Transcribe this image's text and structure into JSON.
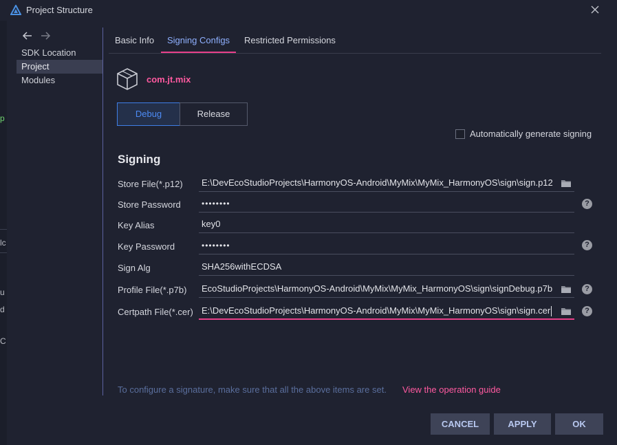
{
  "window": {
    "title": "Project Structure",
    "app_icon": "deveco-triangle-icon",
    "close_icon": "close-icon"
  },
  "left_edge": {
    "chars": [
      "p",
      "lc",
      "u",
      "d",
      "C"
    ]
  },
  "sidebar": {
    "back_icon": "arrow-left-icon",
    "forward_icon": "arrow-right-icon",
    "items": [
      {
        "label": "SDK Location"
      },
      {
        "label": "Project"
      },
      {
        "label": "Modules"
      }
    ],
    "selected": "Project"
  },
  "tabs": [
    {
      "label": "Basic Info"
    },
    {
      "label": "Signing Configs"
    },
    {
      "label": "Restricted Permissions"
    }
  ],
  "active_tab": "Signing Configs",
  "package": {
    "name": "com.jt.mix",
    "icon": "package-box-icon"
  },
  "build_types": {
    "debug": "Debug",
    "release": "Release",
    "selected": "Debug"
  },
  "auto_signing": {
    "label": "Automatically generate signing",
    "checked": false
  },
  "signing": {
    "title": "Signing",
    "store_file": {
      "label": "Store File(*.p12)",
      "value": "E:\\DevEcoStudioProjects\\HarmonyOS-Android\\MyMix\\MyMix_HarmonyOS\\sign\\sign.p12"
    },
    "store_password": {
      "label": "Store Password",
      "value": "••••••••"
    },
    "key_alias": {
      "label": "Key Alias",
      "value": "key0"
    },
    "key_password": {
      "label": "Key Password",
      "value": "••••••••"
    },
    "sign_alg": {
      "label": "Sign Alg",
      "value": "SHA256withECDSA"
    },
    "profile_file": {
      "label": "Profile File(*.p7b)",
      "value": "EcoStudioProjects\\HarmonyOS-Android\\MyMix\\MyMix_HarmonyOS\\sign\\signDebug.p7b"
    },
    "certpath_file": {
      "label": "Certpath File(*.cer)",
      "value": "E:\\DevEcoStudioProjects\\HarmonyOS-Android\\MyMix\\MyMix_HarmonyOS\\sign\\sign.cer"
    },
    "help_glyph": "?"
  },
  "footer": {
    "hint": "To configure a signature, make sure that all the above items are set.",
    "guide_link": "View the operation guide"
  },
  "buttons": {
    "cancel": "CANCEL",
    "apply": "APPLY",
    "ok": "OK"
  },
  "colors": {
    "accent_pink": "#e9408a",
    "accent_blue": "#4d8bf5",
    "background": "#1f2230"
  }
}
